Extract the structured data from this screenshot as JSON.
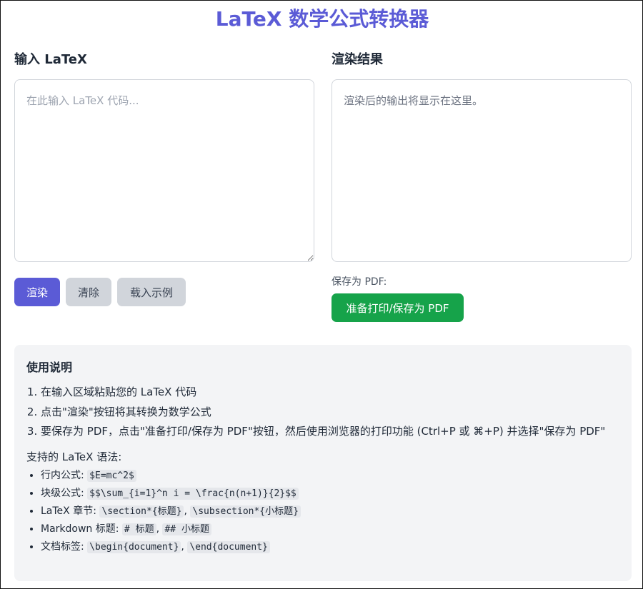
{
  "title": "LaTeX 数学公式转换器",
  "input": {
    "heading": "输入 LaTeX",
    "placeholder": "在此输入 LaTeX 代码...",
    "value": ""
  },
  "output": {
    "heading": "渲染结果",
    "placeholder_text": "渲染后的输出将显示在这里。"
  },
  "buttons": {
    "render": "渲染",
    "clear": "清除",
    "load_example": "载入示例",
    "save_label": "保存为 PDF:",
    "print_pdf": "准备打印/保存为 PDF"
  },
  "help": {
    "heading": "使用说明",
    "steps": [
      "在输入区域粘贴您的 LaTeX 代码",
      "点击\"渲染\"按钮将其转换为数学公式",
      "要保存为 PDF，点击\"准备打印/保存为 PDF\"按钮，然后使用浏览器的打印功能 (Ctrl+P 或 ⌘+P) 并选择\"保存为 PDF\""
    ],
    "supported_label": "支持的 LaTeX 语法:",
    "syntax": [
      {
        "label": "行内公式: ",
        "codes": [
          "$E=mc^2$"
        ]
      },
      {
        "label": "块级公式: ",
        "codes": [
          "$$\\sum_{i=1}^n i = \\frac{n(n+1)}{2}$$"
        ]
      },
      {
        "label": "LaTeX 章节: ",
        "codes": [
          "\\section*{标题}",
          "\\subsection*{小标题}"
        ]
      },
      {
        "label": "Markdown 标题: ",
        "codes": [
          "# 标题",
          "## 小标题"
        ]
      },
      {
        "label": "文档标签: ",
        "codes": [
          "\\begin{document}",
          "\\end{document}"
        ]
      }
    ],
    "separator": ", "
  }
}
